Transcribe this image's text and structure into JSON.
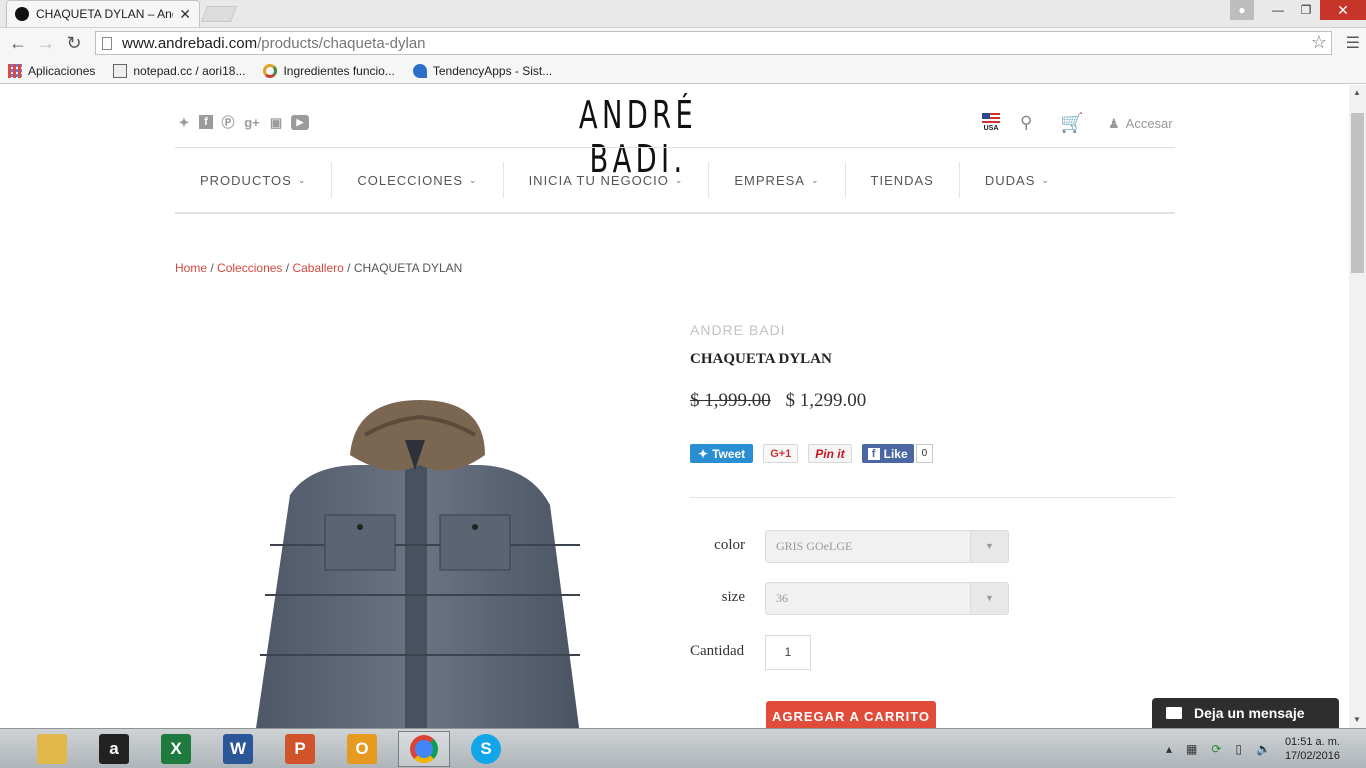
{
  "browser": {
    "tab_title": "CHAQUETA DYLAN – André",
    "tab_close": "✕",
    "url_domain": "www.andrebadi.com",
    "url_path": "/products/chaqueta-dylan",
    "bookmarks": [
      {
        "label": "Aplicaciones",
        "icon": "apps-grid-icon",
        "color": "#4a8af4"
      },
      {
        "label": "notepad.cc / aori18...",
        "icon": "notepad-icon",
        "color": "#666666"
      },
      {
        "label": "Ingredientes funcio...",
        "icon": "chrome-page-icon",
        "color": "#e0a02a"
      },
      {
        "label": "TendencyApps - Sist...",
        "icon": "tendency-icon",
        "color": "#2a6fc9"
      }
    ]
  },
  "site": {
    "logo": "ANDRÉ BADI.",
    "flag_label": "USA",
    "login_label": "Accesar",
    "social_icons": [
      "twitter-icon",
      "facebook-icon",
      "pinterest-icon",
      "google-plus-icon",
      "instagram-icon",
      "youtube-icon"
    ],
    "nav": [
      {
        "label": "PRODUCTOS",
        "has_dropdown": true
      },
      {
        "label": "COLECCIONES",
        "has_dropdown": true
      },
      {
        "label": "INICIA TU NEGOCIO",
        "has_dropdown": true
      },
      {
        "label": "EMPRESA",
        "has_dropdown": true
      },
      {
        "label": "TIENDAS",
        "has_dropdown": false
      },
      {
        "label": "DUDAS",
        "has_dropdown": true
      }
    ],
    "breadcrumb": {
      "home": "Home",
      "colecciones": "Colecciones",
      "caballero": "Caballero",
      "current": "CHAQUETA DYLAN",
      "sep": "/"
    }
  },
  "product": {
    "brand": "ANDRE BADI",
    "title": "CHAQUETA DYLAN",
    "old_price": "$ 1,999.00",
    "price": "$ 1,299.00",
    "share": {
      "tweet": "Tweet",
      "gplus": "G+1",
      "pin": "Pin it",
      "fb_like": "Like",
      "fb_count": "0"
    },
    "color_label": "color",
    "color_value": "GRIS GOeLGE",
    "size_label": "size",
    "size_value": "36",
    "qty_label": "Cantidad",
    "qty_value": "1",
    "add_to_cart": "AGREGAR A CARRITO"
  },
  "chat": {
    "label": "Deja un mensaje"
  },
  "taskbar": {
    "apps": [
      {
        "name": "file-explorer-icon",
        "color": "#e2b84a",
        "glyph": ""
      },
      {
        "name": "amazon-icon",
        "color": "#222222",
        "glyph": "a"
      },
      {
        "name": "excel-icon",
        "color": "#1f7a3d",
        "glyph": "X"
      },
      {
        "name": "word-icon",
        "color": "#2b5799",
        "glyph": "W"
      },
      {
        "name": "powerpoint-icon",
        "color": "#d0532a",
        "glyph": "P"
      },
      {
        "name": "outlook-icon",
        "color": "#e69a1f",
        "glyph": "O"
      },
      {
        "name": "chrome-icon",
        "color": "#ffffff",
        "glyph": ""
      },
      {
        "name": "skype-icon",
        "color": "#12a5e8",
        "glyph": "S"
      }
    ],
    "time": "01:51 a. m.",
    "date": "17/02/2016"
  }
}
